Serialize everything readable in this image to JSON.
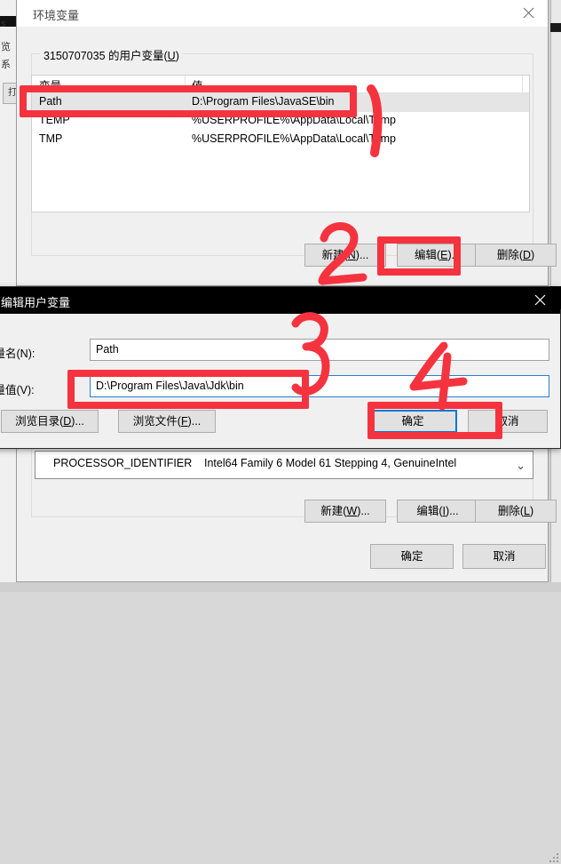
{
  "background": {
    "left_window_glyphs": [
      "s",
      "览",
      "系",
      "打"
    ],
    "description": "partially occluded windows behind"
  },
  "env_dialog": {
    "title": "环境变量",
    "close_icon": "close-icon",
    "user_group_label_prefix": "3150707035 的用户变量(",
    "user_group_label_accel": "U",
    "user_group_label_suffix": ")",
    "columns": [
      "变量",
      "值"
    ],
    "rows": [
      {
        "name": "Path",
        "value": "D:\\Program Files\\JavaSE\\bin",
        "selected": true
      },
      {
        "name": "TEMP",
        "value": "%USERPROFILE%\\AppData\\Local\\Temp",
        "selected": false
      },
      {
        "name": "TMP",
        "value": "%USERPROFILE%\\AppData\\Local\\Temp",
        "selected": false
      }
    ],
    "buttons": {
      "new": "新建(N)...",
      "edit": "编辑(E)...",
      "delete": "删除(D)"
    }
  },
  "sys_area": {
    "row": {
      "name": "PROCESSOR_IDENTIFIER",
      "value": "Intel64 Family 6 Model 61 Stepping 4, GenuineIntel"
    },
    "caret_icon": "chevron-down-icon",
    "buttons": {
      "new": "新建(W)...",
      "edit": "编辑(I)...",
      "delete": "删除(L)"
    },
    "footer": {
      "ok": "确定",
      "cancel": "取消"
    }
  },
  "edit_dialog": {
    "title": "编辑用户变量",
    "close_icon": "close-icon",
    "label_name": "变量名(N):",
    "label_value": "变量值(V):",
    "value_name": "Path",
    "value_value": "D:\\Program Files\\Java\\Jdk\\bin",
    "buttons": {
      "browse_dir": "浏览目录(D)...",
      "browse_file": "浏览文件(F)...",
      "ok": "确定",
      "cancel": "取消"
    }
  },
  "annotations": {
    "color": "#f5333f",
    "marks": [
      {
        "number": "1",
        "target": "selected Path row in user variables list"
      },
      {
        "number": "2",
        "target": "编辑(E)... button"
      },
      {
        "number": "3",
        "target": "变量值(V) text field"
      },
      {
        "number": "4",
        "target": "确定 button of edit dialog"
      }
    ]
  }
}
